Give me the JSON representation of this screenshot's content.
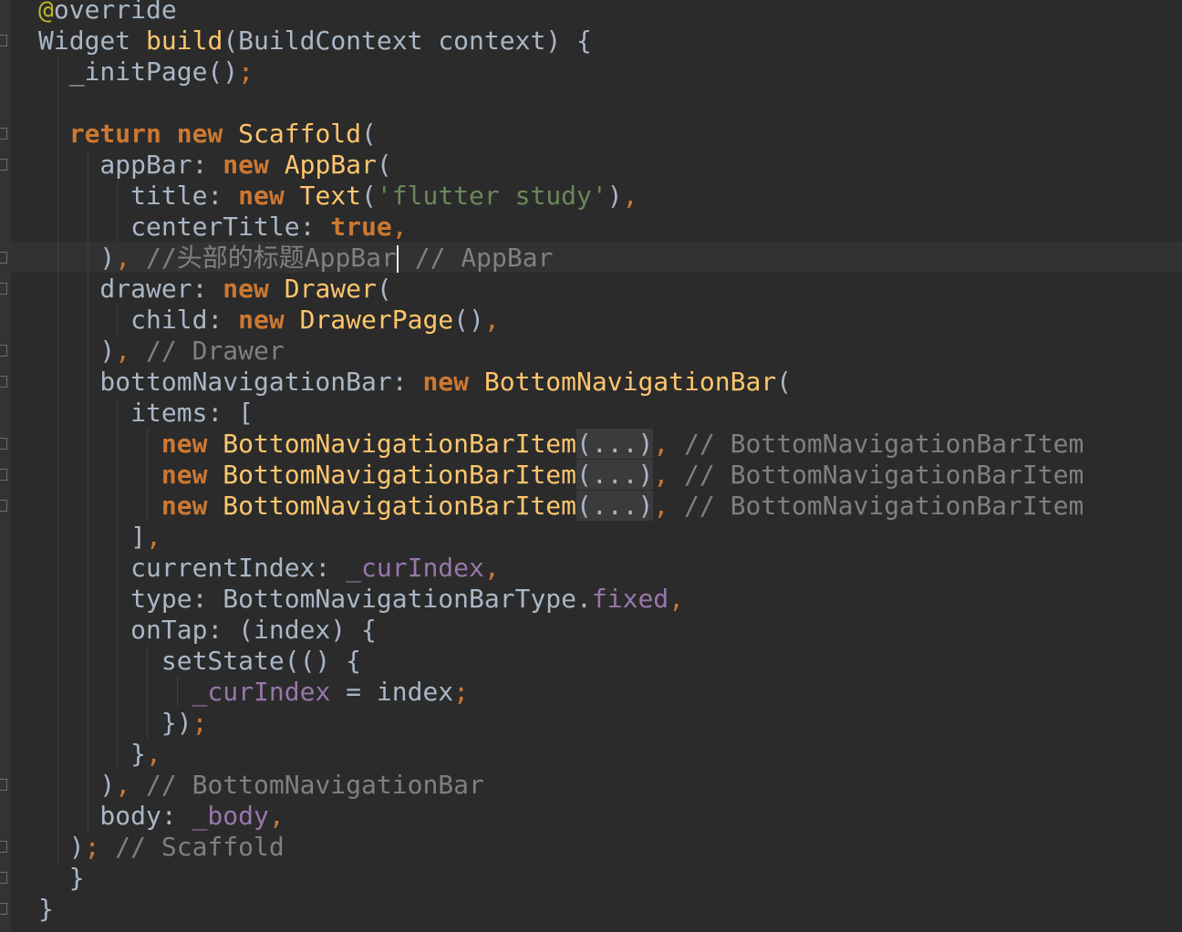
{
  "editor": {
    "language": "Dart",
    "theme": "Darcula",
    "colors": {
      "background": "#2b2b2b",
      "keyword": "#cc7832",
      "annotation": "#bbb529",
      "class": "#ffc66d",
      "string": "#6a8759",
      "comment": "#808080",
      "field": "#9876aa",
      "text": "#a9b7c6"
    },
    "lines": [
      [
        {
          "t": "@",
          "c": "ann"
        },
        {
          "t": "override",
          "c": "txt"
        }
      ],
      [
        {
          "t": "Widget ",
          "c": "txt"
        },
        {
          "t": "build",
          "c": "cls"
        },
        {
          "t": "(BuildContext context) {",
          "c": "txt"
        }
      ],
      [
        {
          "t": "  _initPage()",
          "c": "txt"
        },
        {
          "t": ";",
          "c": "pun"
        }
      ],
      [],
      [
        {
          "t": "  ",
          "c": "txt"
        },
        {
          "t": "return new ",
          "c": "kw"
        },
        {
          "t": "Scaffold",
          "c": "cls"
        },
        {
          "t": "(",
          "c": "txt"
        }
      ],
      [
        {
          "t": "    appBar: ",
          "c": "txt"
        },
        {
          "t": "new ",
          "c": "kw"
        },
        {
          "t": "AppBar",
          "c": "cls"
        },
        {
          "t": "(",
          "c": "txt"
        }
      ],
      [
        {
          "t": "      title: ",
          "c": "txt"
        },
        {
          "t": "new ",
          "c": "kw"
        },
        {
          "t": "Text",
          "c": "cls"
        },
        {
          "t": "(",
          "c": "txt"
        },
        {
          "t": "'flutter study'",
          "c": "str"
        },
        {
          "t": ")",
          "c": "txt"
        },
        {
          "t": ",",
          "c": "pun"
        }
      ],
      [
        {
          "t": "      centerTitle: ",
          "c": "txt"
        },
        {
          "t": "true",
          "c": "kw"
        },
        {
          "t": ",",
          "c": "pun"
        }
      ],
      [
        {
          "t": "    )",
          "c": "txt"
        },
        {
          "t": ", ",
          "c": "pun"
        },
        {
          "t": "//头部的标题AppBar",
          "c": "cmt"
        },
        {
          "t": "",
          "c": "caret"
        },
        {
          "t": " // AppBar",
          "c": "cmt"
        }
      ],
      [
        {
          "t": "    drawer: ",
          "c": "txt"
        },
        {
          "t": "new ",
          "c": "kw"
        },
        {
          "t": "Drawer",
          "c": "cls"
        },
        {
          "t": "(",
          "c": "txt"
        }
      ],
      [
        {
          "t": "      child: ",
          "c": "txt"
        },
        {
          "t": "new ",
          "c": "kw"
        },
        {
          "t": "DrawerPage",
          "c": "cls"
        },
        {
          "t": "()",
          "c": "txt"
        },
        {
          "t": ",",
          "c": "pun"
        }
      ],
      [
        {
          "t": "    )",
          "c": "txt"
        },
        {
          "t": ", ",
          "c": "pun"
        },
        {
          "t": "// Drawer",
          "c": "cmt"
        }
      ],
      [
        {
          "t": "    bottomNavigationBar: ",
          "c": "txt"
        },
        {
          "t": "new ",
          "c": "kw"
        },
        {
          "t": "BottomNavigationBar",
          "c": "cls"
        },
        {
          "t": "(",
          "c": "txt"
        }
      ],
      [
        {
          "t": "      items: [",
          "c": "txt"
        }
      ],
      [
        {
          "t": "        ",
          "c": "txt"
        },
        {
          "t": "new ",
          "c": "kw"
        },
        {
          "t": "BottomNavigationBarItem",
          "c": "cls"
        },
        {
          "t": "(...)",
          "c": "fold"
        },
        {
          "t": ", ",
          "c": "pun"
        },
        {
          "t": "// BottomNavigationBarItem",
          "c": "cmt"
        }
      ],
      [
        {
          "t": "        ",
          "c": "txt"
        },
        {
          "t": "new ",
          "c": "kw"
        },
        {
          "t": "BottomNavigationBarItem",
          "c": "cls"
        },
        {
          "t": "(...)",
          "c": "fold"
        },
        {
          "t": ", ",
          "c": "pun"
        },
        {
          "t": "// BottomNavigationBarItem",
          "c": "cmt"
        }
      ],
      [
        {
          "t": "        ",
          "c": "txt"
        },
        {
          "t": "new ",
          "c": "kw"
        },
        {
          "t": "BottomNavigationBarItem",
          "c": "cls"
        },
        {
          "t": "(...)",
          "c": "fold"
        },
        {
          "t": ", ",
          "c": "pun"
        },
        {
          "t": "// BottomNavigationBarItem",
          "c": "cmt"
        }
      ],
      [
        {
          "t": "      ]",
          "c": "txt"
        },
        {
          "t": ",",
          "c": "pun"
        }
      ],
      [
        {
          "t": "      currentIndex: ",
          "c": "txt"
        },
        {
          "t": "_curIndex",
          "c": "fld"
        },
        {
          "t": ",",
          "c": "pun"
        }
      ],
      [
        {
          "t": "      type: BottomNavigationBarType.",
          "c": "txt"
        },
        {
          "t": "fixed",
          "c": "fld"
        },
        {
          "t": ",",
          "c": "pun"
        }
      ],
      [
        {
          "t": "      onTap: (index) {",
          "c": "txt"
        }
      ],
      [
        {
          "t": "        setState(() {",
          "c": "txt"
        }
      ],
      [
        {
          "t": "          ",
          "c": "txt"
        },
        {
          "t": "_curIndex",
          "c": "fld"
        },
        {
          "t": " = index",
          "c": "txt"
        },
        {
          "t": ";",
          "c": "pun"
        }
      ],
      [
        {
          "t": "        })",
          "c": "txt"
        },
        {
          "t": ";",
          "c": "pun"
        }
      ],
      [
        {
          "t": "      }",
          "c": "txt"
        },
        {
          "t": ",",
          "c": "pun"
        }
      ],
      [
        {
          "t": "    )",
          "c": "txt"
        },
        {
          "t": ", ",
          "c": "pun"
        },
        {
          "t": "// BottomNavigationBar",
          "c": "cmt"
        }
      ],
      [
        {
          "t": "    body: ",
          "c": "txt"
        },
        {
          "t": "_body",
          "c": "fld"
        },
        {
          "t": ",",
          "c": "pun"
        }
      ],
      [
        {
          "t": "  )",
          "c": "txt"
        },
        {
          "t": "; ",
          "c": "pun"
        },
        {
          "t": "// Scaffold",
          "c": "cmt"
        }
      ],
      [
        {
          "t": "  }",
          "c": "txt"
        }
      ],
      [
        {
          "t": "}",
          "c": "txt"
        }
      ]
    ]
  }
}
